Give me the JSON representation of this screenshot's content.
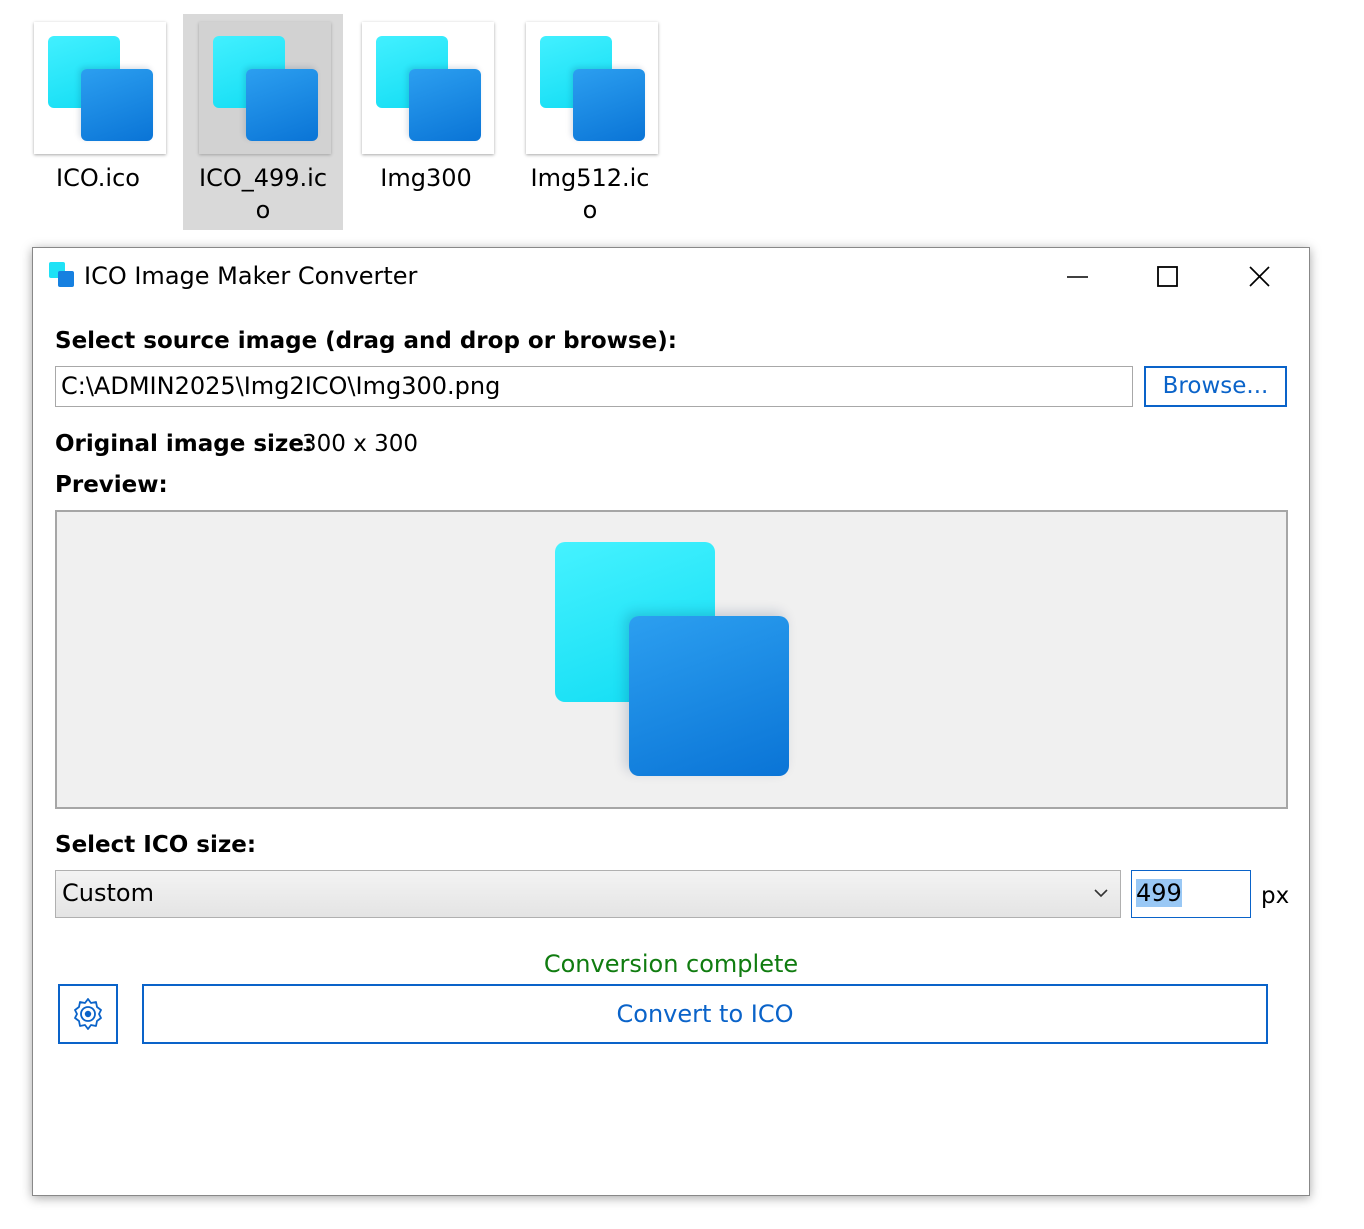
{
  "desktop": {
    "files": [
      {
        "name": "ICO.ico",
        "selected": false
      },
      {
        "name": "ICO_499.ico",
        "selected": true
      },
      {
        "name": "Img300",
        "selected": false
      },
      {
        "name": "Img512.ico",
        "selected": false
      }
    ]
  },
  "window": {
    "title": "ICO Image Maker Converter",
    "controls": {
      "minimize": "minimize-icon",
      "maximize": "maximize-icon",
      "close": "close-icon"
    }
  },
  "source": {
    "label": "Select source image (drag and drop or browse):",
    "path": "C:\\ADMIN2025\\Img2ICO\\Img300.png",
    "browse_label": "Browse..."
  },
  "original": {
    "label": "Original image size:",
    "value": "300 x 300"
  },
  "preview": {
    "label": "Preview:"
  },
  "ico_size": {
    "label": "Select ICO size:",
    "selected": "Custom",
    "custom_value": "499",
    "unit": "px"
  },
  "status": {
    "text": "Conversion complete",
    "color": "#107c10"
  },
  "actions": {
    "settings_icon": "gear-icon",
    "convert_label": "Convert to ICO"
  },
  "colors": {
    "accent": "#0a63c9",
    "cyan": "#1ee2f6",
    "blue": "#1680e0"
  }
}
